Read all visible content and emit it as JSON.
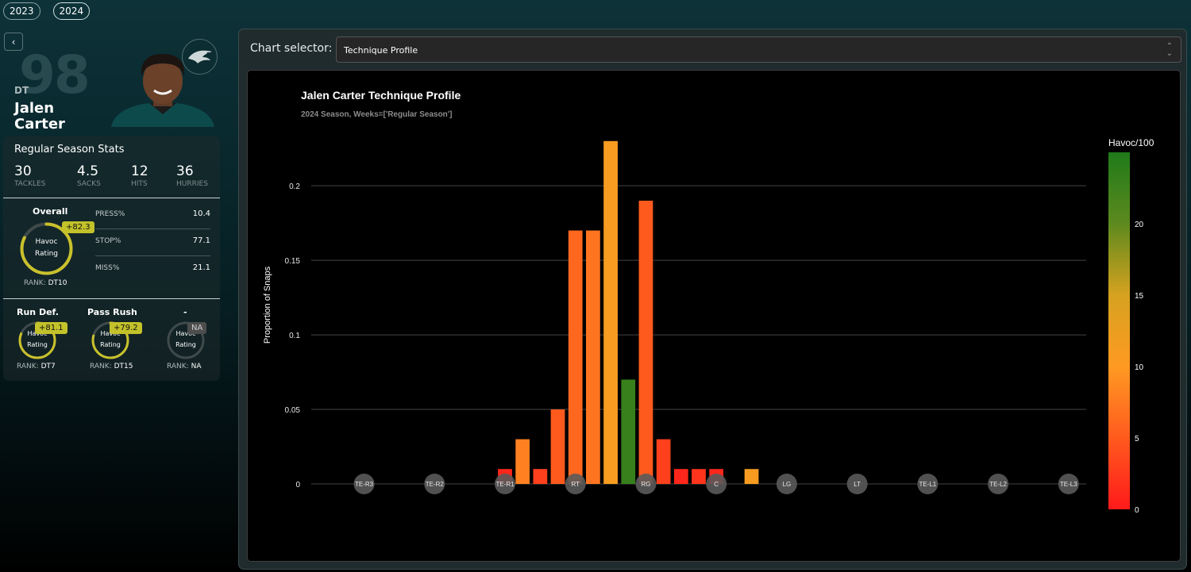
{
  "years": [
    "2023",
    "2024"
  ],
  "active_year": "2024",
  "player": {
    "back_label": "‹",
    "jersey": "98",
    "position": "DT",
    "first_name": "Jalen",
    "last_name": "Carter"
  },
  "stats": {
    "title": "Regular Season Stats",
    "totals": [
      {
        "value": "30",
        "label": "TACKLES"
      },
      {
        "value": "4.5",
        "label": "SACKS"
      },
      {
        "value": "12",
        "label": "HITS"
      },
      {
        "value": "36",
        "label": "HURRIES"
      }
    ],
    "overall": {
      "title": "Overall",
      "badge": "+82.3",
      "ring_label_1": "Havoc",
      "ring_label_2": "Rating",
      "rank_label": "RANK:",
      "rank_value": "DT10",
      "ring_fraction": 0.823
    },
    "metrics": [
      {
        "key": "PRESS%",
        "value": "10.4"
      },
      {
        "key": "STOP%",
        "value": "77.1"
      },
      {
        "key": "MISS%",
        "value": "21.1"
      }
    ],
    "sub_ratings": [
      {
        "title": "Run Def.",
        "badge": "+81.1",
        "ring_label_1": "Havoc",
        "ring_label_2": "Rating",
        "rank_label": "RANK:",
        "rank_value": "DT7",
        "ring_fraction": 0.811
      },
      {
        "title": "Pass Rush",
        "badge": "+79.2",
        "ring_label_1": "Havoc",
        "ring_label_2": "Rating",
        "rank_label": "RANK:",
        "rank_value": "DT15",
        "ring_fraction": 0.792
      },
      {
        "title": "-",
        "badge": "NA",
        "ring_label_1": "Havoc",
        "ring_label_2": "Rating",
        "rank_label": "RANK:",
        "rank_value": "NA",
        "ring_fraction": 0
      }
    ]
  },
  "selector": {
    "label": "Chart selector:",
    "value": "Technique Profile"
  },
  "colors": {
    "accent_badge": "#c3c22a",
    "ring": "#c9c12c"
  },
  "chart_data": {
    "type": "bar",
    "title": "Jalen Carter Technique Profile",
    "subtitle": "2024 Season, Weeks=['Regular Season']",
    "ylabel": "Proportion of Snaps",
    "ylim": [
      0,
      0.24
    ],
    "yticks": [
      0,
      0.05,
      0.1,
      0.15,
      0.2
    ],
    "ytick_labels": [
      "0",
      "0.05",
      "0.1",
      "0.15",
      "0.2"
    ],
    "x_markers": [
      "TE-R3",
      "TE-R2",
      "TE-R1",
      "RT",
      "RG",
      "C",
      "LG",
      "LT",
      "TE-L1",
      "TE-L2",
      "TE-L3"
    ],
    "x_range": [
      -1.5,
      20.5
    ],
    "bars": [
      {
        "x": 4,
        "value": 0.01,
        "havoc": 1
      },
      {
        "x": 4.5,
        "value": 0.03,
        "havoc": 8
      },
      {
        "x": 5,
        "value": 0.01,
        "havoc": 3
      },
      {
        "x": 5.5,
        "value": 0.05,
        "havoc": 5
      },
      {
        "x": 6,
        "value": 0.17,
        "havoc": 6
      },
      {
        "x": 6.5,
        "value": 0.17,
        "havoc": 7
      },
      {
        "x": 7,
        "value": 0.23,
        "havoc": 11
      },
      {
        "x": 7.5,
        "value": 0.07,
        "havoc": 23
      },
      {
        "x": 8,
        "value": 0.19,
        "havoc": 5
      },
      {
        "x": 8.5,
        "value": 0.03,
        "havoc": 3
      },
      {
        "x": 9,
        "value": 0.01,
        "havoc": 1
      },
      {
        "x": 9.5,
        "value": 0.01,
        "havoc": 2
      },
      {
        "x": 10,
        "value": 0.01,
        "havoc": 1
      },
      {
        "x": 11,
        "value": 0.01,
        "havoc": 11
      }
    ],
    "colorbar": {
      "title": "Havoc/100",
      "range": [
        0,
        25
      ],
      "ticks": [
        0,
        5,
        10,
        15,
        20
      ],
      "tick_labels": [
        "0",
        "5",
        "10",
        "15",
        "20"
      ],
      "colors": [
        "#ff1a1a",
        "#ff5a1e",
        "#ff9a22",
        "#d6a21f",
        "#5d8a1e",
        "#1f7a1a"
      ]
    },
    "grid": true,
    "legend": "colorbar-right"
  }
}
